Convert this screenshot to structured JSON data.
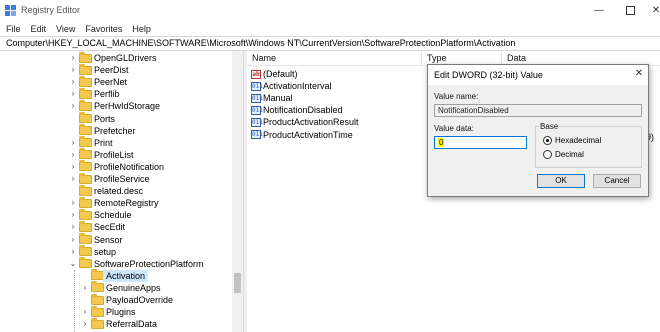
{
  "window": {
    "title": "Registry Editor",
    "minimize_glyph": "—",
    "close_glyph": "✕"
  },
  "menu": [
    "File",
    "Edit",
    "View",
    "Favorites",
    "Help"
  ],
  "address": "Computer\\HKEY_LOCAL_MACHINE\\SOFTWARE\\Microsoft\\Windows NT\\CurrentVersion\\SoftwareProtectionPlatform\\Activation",
  "tree": {
    "items": [
      {
        "label": "OpenGLDrivers",
        "level": 1,
        "expandable": true
      },
      {
        "label": "PeerDist",
        "level": 1,
        "expandable": true
      },
      {
        "label": "PeerNet",
        "level": 1,
        "expandable": true
      },
      {
        "label": "Perflib",
        "level": 1,
        "expandable": true
      },
      {
        "label": "PerHwIdStorage",
        "level": 1,
        "expandable": true
      },
      {
        "label": "Ports",
        "level": 1,
        "expandable": false
      },
      {
        "label": "Prefetcher",
        "level": 1,
        "expandable": false
      },
      {
        "label": "Print",
        "level": 1,
        "expandable": true
      },
      {
        "label": "ProfileList",
        "level": 1,
        "expandable": true
      },
      {
        "label": "ProfileNotification",
        "level": 1,
        "expandable": true
      },
      {
        "label": "ProfileService",
        "level": 1,
        "expandable": true
      },
      {
        "label": "related.desc",
        "level": 1,
        "expandable": false
      },
      {
        "label": "RemoteRegistry",
        "level": 1,
        "expandable": true
      },
      {
        "label": "Schedule",
        "level": 1,
        "expandable": true
      },
      {
        "label": "SecEdit",
        "level": 1,
        "expandable": true
      },
      {
        "label": "Sensor",
        "level": 1,
        "expandable": true
      },
      {
        "label": "setup",
        "level": 1,
        "expandable": true
      },
      {
        "label": "SoftwareProtectionPlatform",
        "level": 1,
        "expandable": true,
        "expanded": true
      },
      {
        "label": "Activation",
        "level": 2,
        "expandable": false,
        "selected": true
      },
      {
        "label": "GenuineApps",
        "level": 2,
        "expandable": true
      },
      {
        "label": "PayloadOverride",
        "level": 2,
        "expandable": false
      },
      {
        "label": "Plugins",
        "level": 2,
        "expandable": true
      },
      {
        "label": "ReferralData",
        "level": 2,
        "expandable": true
      }
    ],
    "chevron_collapsed": "›",
    "chevron_expanded": "⌄"
  },
  "list": {
    "columns": [
      "Name",
      "Type",
      "Data"
    ],
    "values": [
      {
        "name": "(Default)",
        "kind": "string",
        "icon": "ab"
      },
      {
        "name": "ActivationInterval",
        "kind": "dword",
        "icon": "011"
      },
      {
        "name": "Manual",
        "kind": "dword",
        "icon": "011"
      },
      {
        "name": "NotificationDisabled",
        "kind": "dword",
        "icon": "011"
      },
      {
        "name": "ProductActivationResult",
        "kind": "dword",
        "icon": "011"
      },
      {
        "name": "ProductActivationTime",
        "kind": "dword",
        "icon": "011"
      }
    ],
    "peek_data": "9)"
  },
  "dialog": {
    "title": "Edit DWORD (32-bit) Value",
    "close_glyph": "✕",
    "value_name_label": "Value name:",
    "value_name": "NotificationDisabled",
    "value_data_label": "Value data:",
    "value_data": "0",
    "base_label": "Base",
    "base_options": [
      {
        "label": "Hexadecimal",
        "selected": true
      },
      {
        "label": "Decimal",
        "selected": false
      }
    ],
    "ok_label": "OK",
    "cancel_label": "Cancel"
  },
  "colors": {
    "folder": "#f2c94c",
    "selection": "#cce8ff",
    "accent": "#0078d7"
  }
}
